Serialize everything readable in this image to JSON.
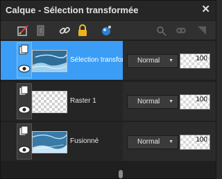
{
  "window": {
    "title": "Calque - Sélection transformée",
    "close_glyph": "✕"
  },
  "toolbar": {
    "icons": [
      "edit-layer-icon",
      "layer-group-icon",
      "link-icon",
      "lock-icon",
      "mask-icon",
      "vector-tool-icon",
      "mask-view-icon",
      "corner-icon"
    ]
  },
  "layers": [
    {
      "name": "Sélection transformée",
      "selected": true,
      "blend": "Normal",
      "opacity": "100",
      "thumbnail": "blue-texture-icon"
    },
    {
      "name": "Raster 1",
      "selected": false,
      "blend": "Normal",
      "opacity": "100",
      "thumbnail": "transparent-icon"
    },
    {
      "name": "Fusionné",
      "selected": false,
      "blend": "Normal",
      "opacity": "100",
      "thumbnail": "blue-texture-icon"
    }
  ],
  "colors": {
    "selection": "#3b9df5",
    "background": "#1f1f1f"
  }
}
